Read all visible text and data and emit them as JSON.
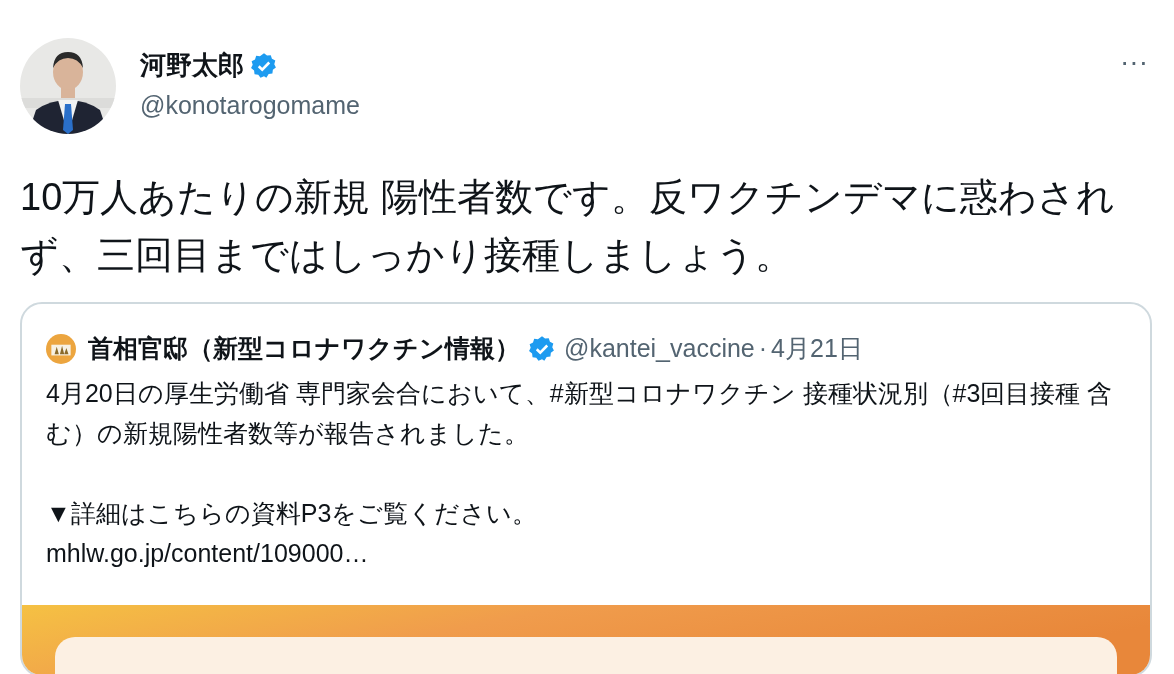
{
  "author": {
    "name": "河野太郎",
    "verified": true,
    "handle": "@konotarogomame"
  },
  "more": "···",
  "text": "10万人あたりの新規 陽性者数です。反ワクチンデマに惑わされず、三回目まではしっかり接種しましょう。",
  "quoted": {
    "name": "首相官邸（新型コロナワクチン情報）",
    "verified": true,
    "handle": "@kantei_vaccine",
    "separator": "·",
    "date": "4月21日",
    "paragraphs": [
      "4月20日の厚生労働省 専門家会合において、#新型コロナワクチン 接種状況別（#3回目接種 含む）の新規陽性者数等が報告されました。",
      "▼詳細はこちらの資料P3をご覧ください。"
    ],
    "link": "mhlw.go.jp/content/109000…"
  }
}
